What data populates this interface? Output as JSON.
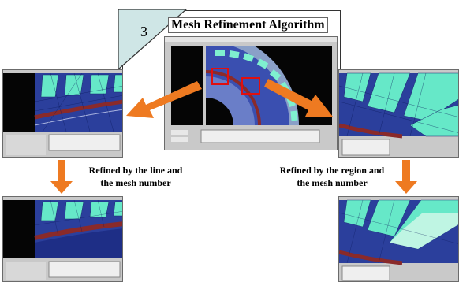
{
  "title": {
    "step_number": "3",
    "text": "Mesh Refinement Algorithm"
  },
  "captions": {
    "left_line1": "Refined by the line and",
    "left_line2": "the mesh number",
    "right_line1": "Refined by the region and",
    "right_line2": "the mesh number"
  },
  "colors": {
    "arrow": "#ee7a21",
    "mesh_blue": "#2b3f9c",
    "mesh_cyan": "#66e8c8",
    "dark_pane": "#050505",
    "ui_gray": "#c9c9c9",
    "highlight_red": "#e01010",
    "triangle_fill": "#cfe6e6"
  }
}
